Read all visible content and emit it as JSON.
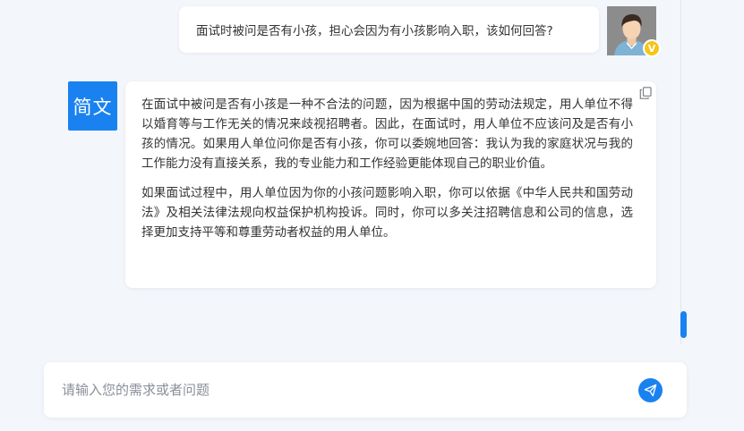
{
  "user_message": {
    "text": "面试时被问是否有小孩，担心会因为有小孩影响入职，该如何回答?",
    "avatar_icon": "user-avatar-icon",
    "badge": "V"
  },
  "bot_message": {
    "avatar_label": "简文",
    "paragraphs": [
      "在面试中被问是否有小孩是一种不合法的问题，因为根据中国的劳动法规定，用人单位不得以婚育等与工作无关的情况来歧视招聘者。因此，在面试时，用人单位不应该问及是否有小孩的情况。如果用人单位问你是否有小孩，你可以委婉地回答：我认为我的家庭状况与我的工作能力没有直接关系，我的专业能力和工作经验更能体现自己的职业价值。",
      "如果面试过程中，用人单位因为你的小孩问题影响入职，你可以依据《中华人民共和国劳动法》及相关法律法规向权益保护机构投诉。同时，你可以多关注招聘信息和公司的信息，选择更加支持平等和尊重劳动者权益的用人单位。"
    ],
    "copy_icon": "copy-icon"
  },
  "composer": {
    "placeholder": "请输入您的需求或者问题",
    "send_icon": "send-icon"
  },
  "colors": {
    "accent": "#1a82f0",
    "background": "#f3f6fb",
    "badge": "#f5c518"
  }
}
